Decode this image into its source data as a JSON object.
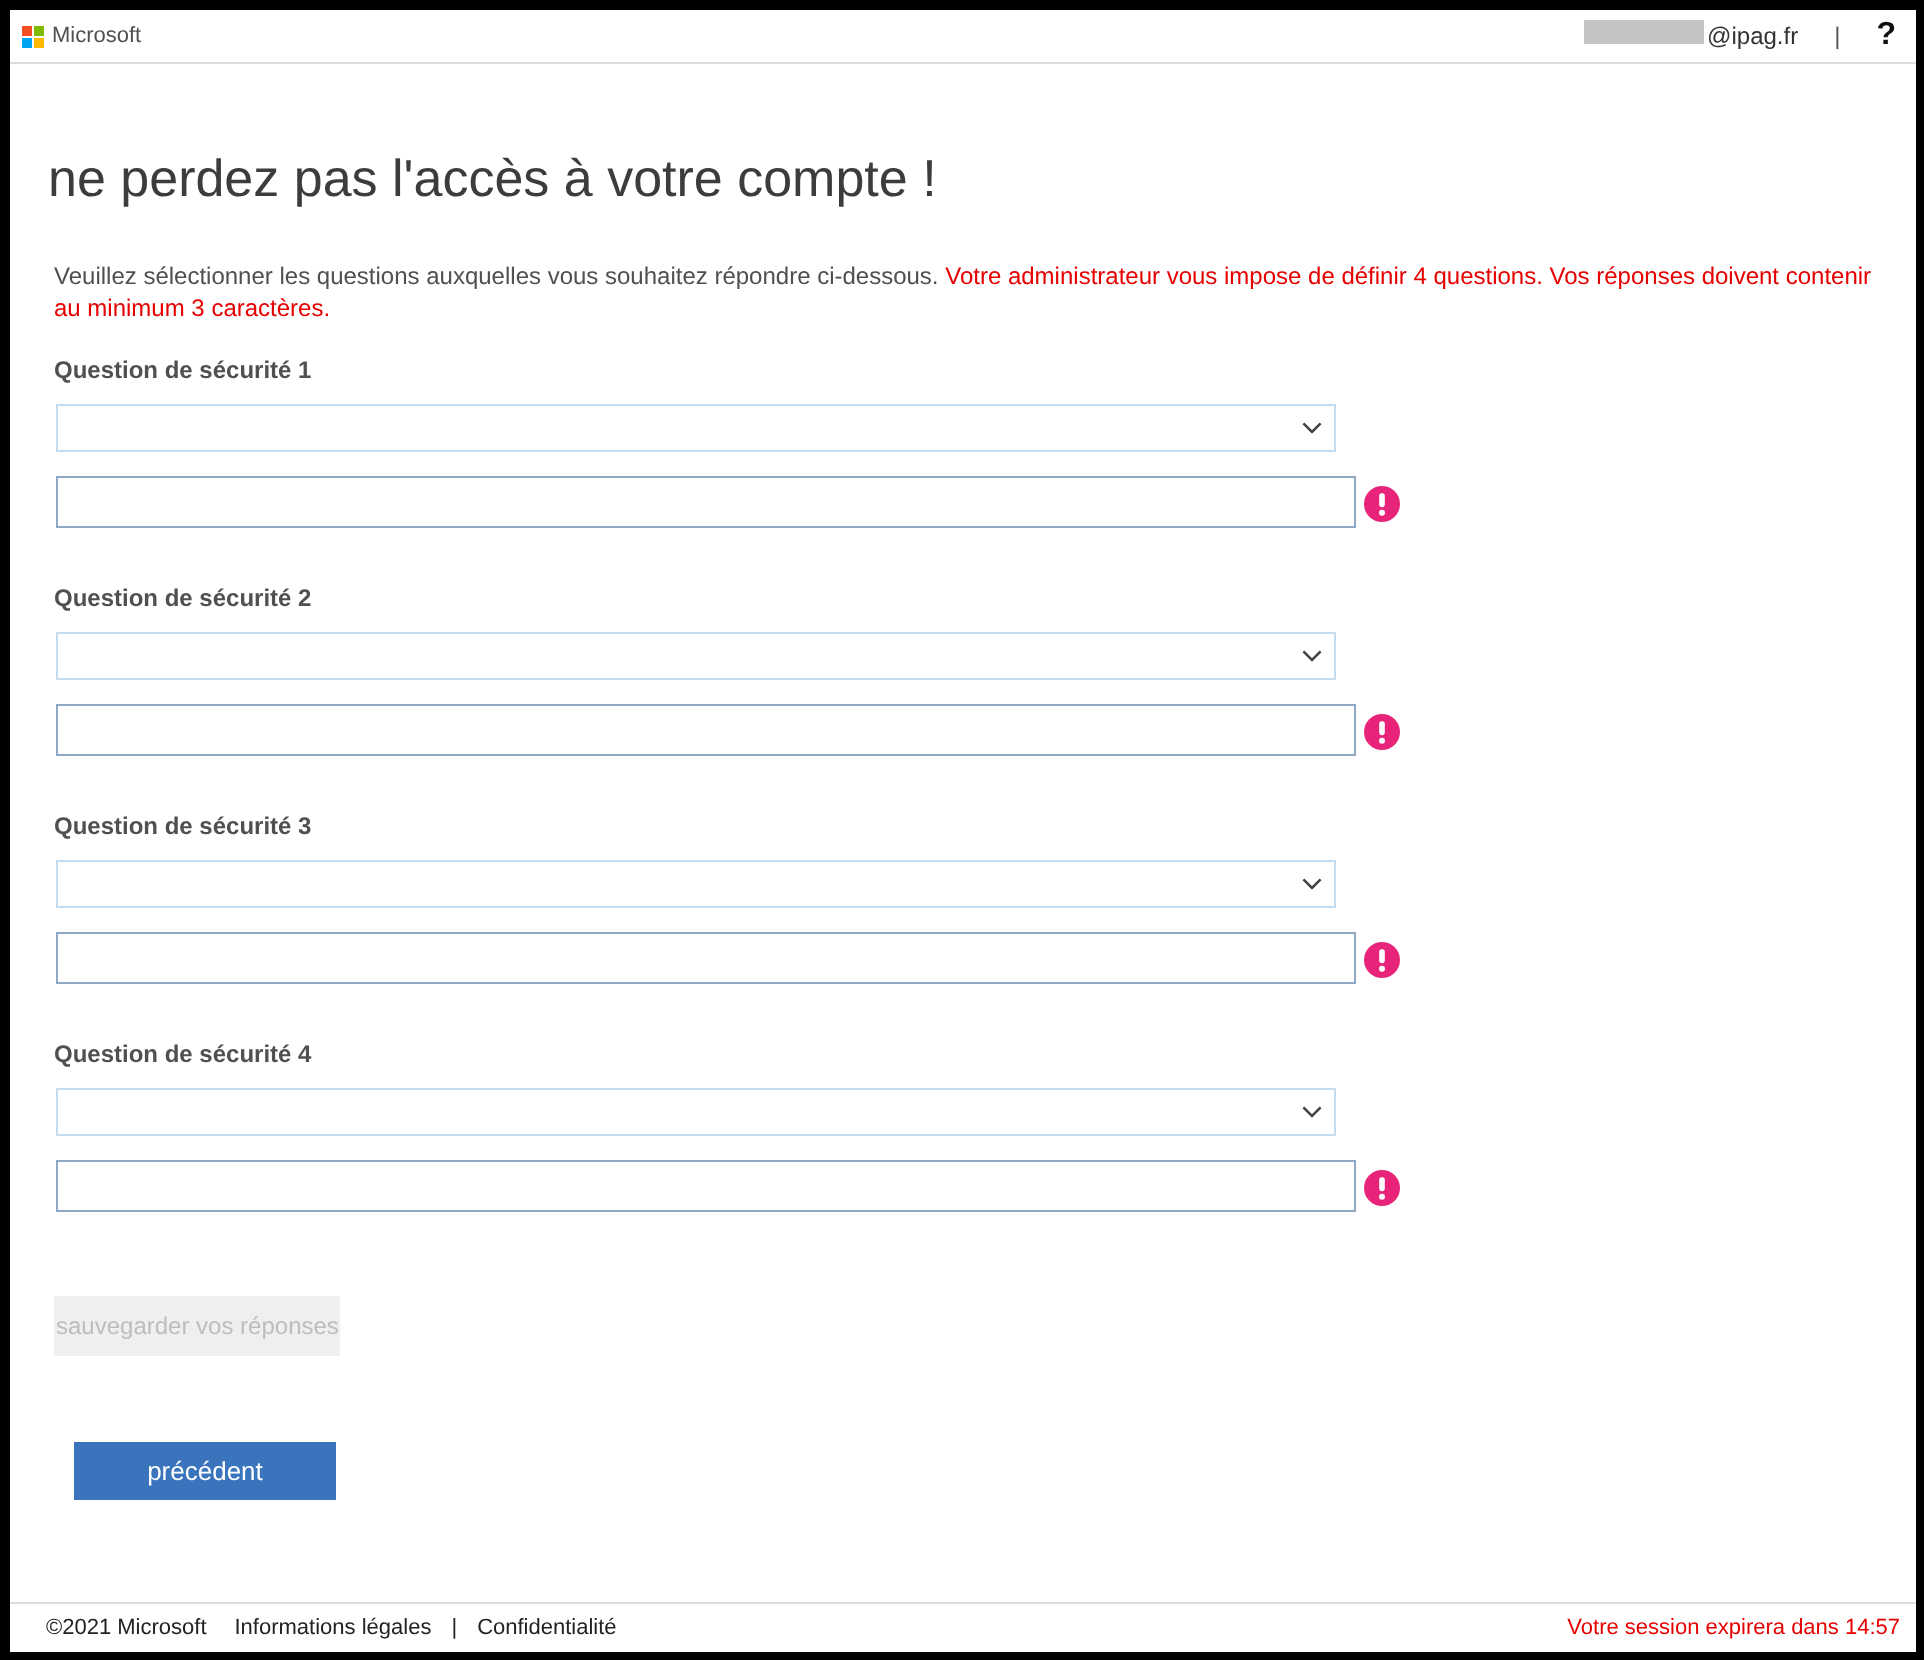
{
  "header": {
    "brand": "Microsoft",
    "account_suffix": "@ipag.fr",
    "separator": "|",
    "help": "?"
  },
  "title": "ne perdez pas l'accès à votre compte !",
  "intro": {
    "text": "Veuillez sélectionner les questions auxquelles vous souhaitez répondre ci-dessous.",
    "notice": "Votre administrateur vous impose de définir 4 questions. Vos réponses doivent contenir au minimum 3 caractères."
  },
  "questions": [
    {
      "label": "Question de sécurité 1",
      "error": true
    },
    {
      "label": "Question de sécurité 2",
      "error": true
    },
    {
      "label": "Question de sécurité 3",
      "error": true
    },
    {
      "label": "Question de sécurité 4",
      "error": true
    }
  ],
  "save_button": {
    "label": "sauvegarder vos réponses",
    "disabled": true
  },
  "back_button": {
    "label": "précédent"
  },
  "footer": {
    "copyright": "©2021 Microsoft",
    "links": [
      {
        "label": "Informations légales"
      },
      {
        "label": "Confidentialité"
      }
    ],
    "separator": "|",
    "session_notice": "Votre session expirera dans 14:57"
  }
}
